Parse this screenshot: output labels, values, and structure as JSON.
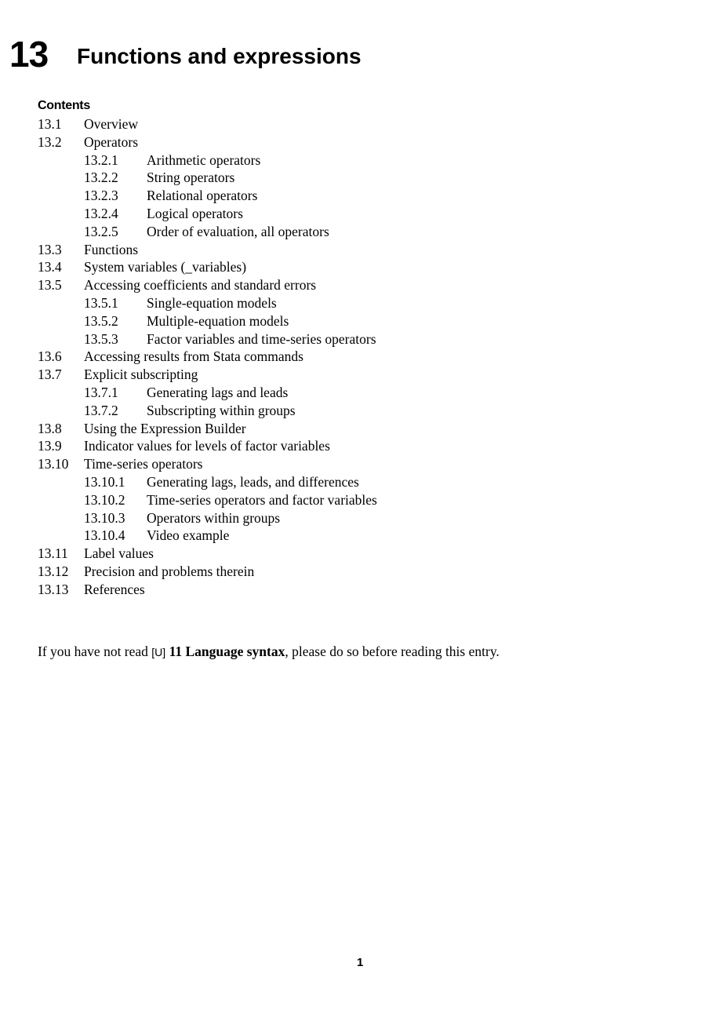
{
  "chapter": {
    "number": "13",
    "title": "Functions and expressions"
  },
  "contents": {
    "label": "Contents",
    "items": [
      {
        "num": "13.1",
        "title": "Overview",
        "level": 1
      },
      {
        "num": "13.2",
        "title": "Operators",
        "level": 1
      },
      {
        "num": "13.2.1",
        "title": "Arithmetic operators",
        "level": 2
      },
      {
        "num": "13.2.2",
        "title": "String operators",
        "level": 2
      },
      {
        "num": "13.2.3",
        "title": "Relational operators",
        "level": 2
      },
      {
        "num": "13.2.4",
        "title": "Logical operators",
        "level": 2
      },
      {
        "num": "13.2.5",
        "title": "Order of evaluation, all operators",
        "level": 2
      },
      {
        "num": "13.3",
        "title": "Functions",
        "level": 1
      },
      {
        "num": "13.4",
        "title": "System variables (_variables)",
        "level": 1
      },
      {
        "num": "13.5",
        "title": "Accessing coefficients and standard errors",
        "level": 1
      },
      {
        "num": "13.5.1",
        "title": "Single-equation models",
        "level": 2
      },
      {
        "num": "13.5.2",
        "title": "Multiple-equation models",
        "level": 2
      },
      {
        "num": "13.5.3",
        "title": "Factor variables and time-series operators",
        "level": 2
      },
      {
        "num": "13.6",
        "title": "Accessing results from Stata commands",
        "level": 1
      },
      {
        "num": "13.7",
        "title": "Explicit subscripting",
        "level": 1
      },
      {
        "num": "13.7.1",
        "title": "Generating lags and leads",
        "level": 2
      },
      {
        "num": "13.7.2",
        "title": "Subscripting within groups",
        "level": 2
      },
      {
        "num": "13.8",
        "title": "Using the Expression Builder",
        "level": 1
      },
      {
        "num": "13.9",
        "title": "Indicator values for levels of factor variables",
        "level": 1
      },
      {
        "num": "13.10",
        "title": "Time-series operators",
        "level": 1
      },
      {
        "num": "13.10.1",
        "title": "Generating lags, leads, and differences",
        "level": 2
      },
      {
        "num": "13.10.2",
        "title": "Time-series operators and factor variables",
        "level": 2
      },
      {
        "num": "13.10.3",
        "title": "Operators within groups",
        "level": 2
      },
      {
        "num": "13.10.4",
        "title": "Video example",
        "level": 2
      },
      {
        "num": "13.11",
        "title": "Label values",
        "level": 1
      },
      {
        "num": "13.12",
        "title": "Precision and problems therein",
        "level": 1
      },
      {
        "num": "13.13",
        "title": "References",
        "level": 1
      }
    ]
  },
  "intro": {
    "before": "If you have not read ",
    "ref_tag": "[U]",
    "ref_title": "11 Language syntax",
    "after": ", please do so before reading this entry."
  },
  "page_number": "1"
}
